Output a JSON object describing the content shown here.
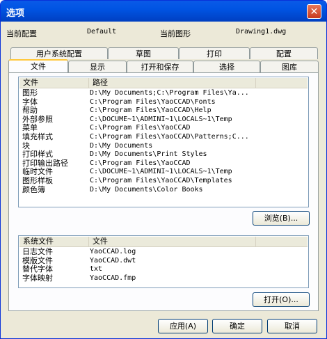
{
  "window": {
    "title": "选项",
    "close_glyph": "✕"
  },
  "info": {
    "config_label": "当前配置",
    "config_value": "Default",
    "drawing_label": "当前图形",
    "drawing_value": "Drawing1.dwg"
  },
  "tabs_back": [
    "用户系统配置",
    "草图",
    "打印",
    "配置"
  ],
  "tabs_front": [
    "文件",
    "显示",
    "打开和保存",
    "选择",
    "图库"
  ],
  "active_tab": "文件",
  "paths": {
    "header_name": "文件",
    "header_path": "路径",
    "rows": [
      {
        "name": "图形",
        "path": "D:\\My Documents;C:\\Program Files\\Ya..."
      },
      {
        "name": "字体",
        "path": "C:\\Program Files\\YaoCCAD\\Fonts"
      },
      {
        "name": "帮助",
        "path": "C:\\Program Files\\YaoCCAD\\Help"
      },
      {
        "name": "外部参照",
        "path": "C:\\DOCUME~1\\ADMINI~1\\LOCALS~1\\Temp"
      },
      {
        "name": "菜单",
        "path": "C:\\Program Files\\YaoCCAD"
      },
      {
        "name": "填充样式",
        "path": "C:\\Program Files\\YaoCCAD\\Patterns;C..."
      },
      {
        "name": "块",
        "path": "D:\\My Documents"
      },
      {
        "name": "打印样式",
        "path": "D:\\My Documents\\Print Styles"
      },
      {
        "name": "打印输出路径",
        "path": "C:\\Program Files\\YaoCCAD"
      },
      {
        "name": "临时文件",
        "path": "C:\\DOCUME~1\\ADMINI~1\\LOCALS~1\\Temp"
      },
      {
        "name": "图形样板",
        "path": "C:\\Program Files\\YaoCCAD\\Templates"
      },
      {
        "name": "颜色簿",
        "path": "D:\\My Documents\\Color Books"
      }
    ]
  },
  "browse_button": "浏览(B)...",
  "sysfiles": {
    "header_name": "系统文件",
    "header_file": "文件",
    "rows": [
      {
        "name": "日志文件",
        "file": "YaoCCAD.log"
      },
      {
        "name": "模版文件",
        "file": "YaoCCAD.dwt"
      },
      {
        "name": "替代字体",
        "file": "txt"
      },
      {
        "name": "字体映射",
        "file": "YaoCCAD.fmp"
      }
    ]
  },
  "open_button": "打开(O)...",
  "footer": {
    "apply": "应用(A)",
    "ok": "确定",
    "cancel": "取消"
  }
}
